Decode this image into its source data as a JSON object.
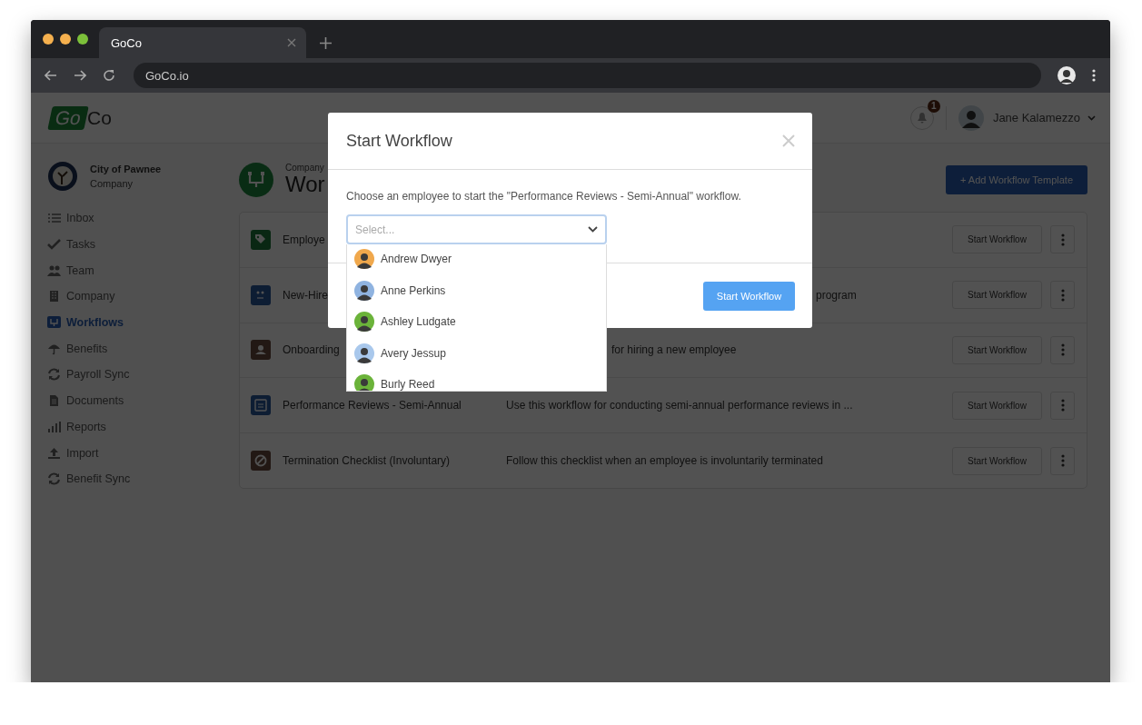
{
  "browser": {
    "tab_title": "GoCo",
    "url": "GoCo.io"
  },
  "header": {
    "logo": [
      "Go",
      "Co"
    ],
    "notification_count": "1",
    "user_name": "Jane Kalamezzo"
  },
  "company": {
    "name": "City of Pawnee",
    "type": "Company"
  },
  "sidebar": {
    "items": [
      {
        "label": "Inbox",
        "kind": "inbox",
        "selected": false
      },
      {
        "label": "Tasks",
        "kind": "check",
        "selected": false
      },
      {
        "label": "Team",
        "kind": "team",
        "selected": false
      },
      {
        "label": "Company",
        "kind": "building",
        "selected": false
      },
      {
        "label": "Workflows",
        "kind": "workflow",
        "selected": true
      },
      {
        "label": "Benefits",
        "kind": "umbrella",
        "selected": false
      },
      {
        "label": "Payroll Sync",
        "kind": "sync",
        "selected": false
      },
      {
        "label": "Documents",
        "kind": "document",
        "selected": false
      },
      {
        "label": "Reports",
        "kind": "chart",
        "selected": false
      },
      {
        "label": "Import",
        "kind": "upload",
        "selected": false
      },
      {
        "label": "Benefit Sync",
        "kind": "sync",
        "selected": false
      }
    ]
  },
  "page": {
    "breadcrumb": "Company",
    "title": "Wor",
    "add_button": "+ Add Workflow Template"
  },
  "workflows": [
    {
      "name": "Employe",
      "kind": "tag",
      "button": "Start Workflow"
    },
    {
      "name": "New-Hire",
      "description": "program",
      "kind": "people",
      "button": "Start Workflow"
    },
    {
      "name": "Onboarding",
      "description": "for hiring a new employee",
      "kind": "person",
      "button": "Start Workflow"
    },
    {
      "name": "Performance Reviews - Semi-Annual",
      "description": "Use this workflow for conducting semi-annual performance reviews in ...",
      "kind": "calendar",
      "button": "Start Workflow"
    },
    {
      "name": "Termination Checklist (Involuntary)",
      "description": "Follow this checklist when an employee is involuntarily terminated",
      "kind": "ban",
      "button": "Start Workflow"
    }
  ],
  "modal": {
    "title": "Start Workflow",
    "message": "Choose an employee to start the \"Performance Reviews - Semi-Annual\" workflow.",
    "select": {
      "placeholder": "Select...",
      "expanded": true
    },
    "button": "Start Workflow"
  },
  "employees": [
    {
      "name": "Andrew Dwyer",
      "color": "#f0a84c"
    },
    {
      "name": "Anne Perkins",
      "color": "#8fb3e0"
    },
    {
      "name": "Ashley Ludgate",
      "color": "#6bb33a"
    },
    {
      "name": "Avery Jessup",
      "color": "#a9c8ec"
    },
    {
      "name": "Burly Reed",
      "color": "#6bb33a"
    }
  ]
}
